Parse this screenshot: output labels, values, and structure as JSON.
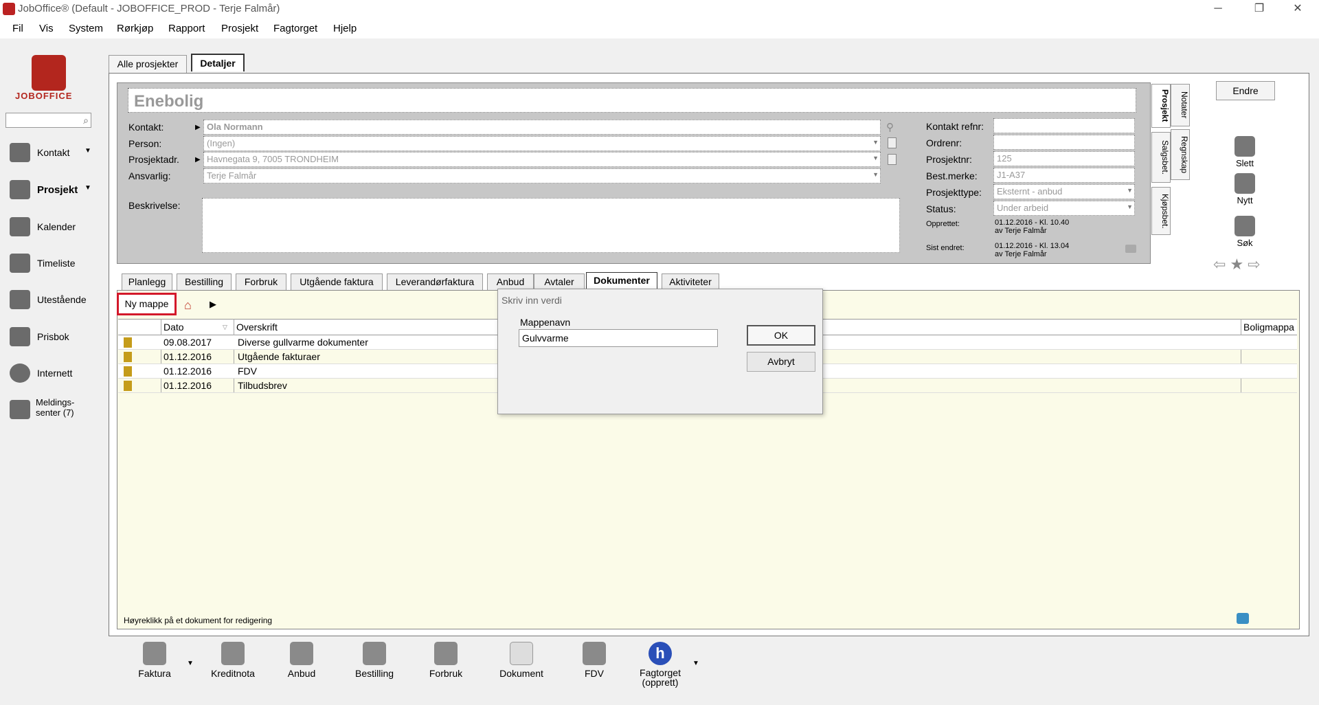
{
  "window": {
    "title": "JobOffice®    (Default - JOBOFFICE_PROD - Terje Falmår)",
    "minimize": "─",
    "restore": "❐",
    "close": "✕"
  },
  "menu": [
    "Fil",
    "Vis",
    "System",
    "Rørkjøp",
    "Rapport",
    "Prosjekt",
    "Fagtorget",
    "Hjelp"
  ],
  "sidebar": {
    "logo": "JOBOFFICE",
    "items": [
      {
        "label": "Kontakt",
        "icon": "contact-icon"
      },
      {
        "label": "Prosjekt",
        "icon": "project-icon"
      },
      {
        "label": "Kalender",
        "icon": "calendar-icon"
      },
      {
        "label": "Timeliste",
        "icon": "clock-icon"
      },
      {
        "label": "Utestående",
        "icon": "money-icon"
      },
      {
        "label": "Prisbok",
        "icon": "book-icon"
      },
      {
        "label": "Internett",
        "icon": "globe-icon"
      },
      {
        "label": "Meldings-",
        "label2": "senter (7)",
        "icon": "message-icon"
      }
    ]
  },
  "top_tabs": [
    "Alle prosjekter",
    "Detaljer"
  ],
  "project": {
    "title": "Enebolig",
    "labels": {
      "kontakt": "Kontakt:",
      "person": "Person:",
      "adresse": "Prosjektadr.",
      "ansvarlig": "Ansvarlig:",
      "beskrivelse": "Beskrivelse:"
    },
    "values": {
      "kontakt": "Ola Normann",
      "person": "(Ingen)",
      "adresse": "Havnegata 9, 7005 TRONDHEIM",
      "ansvarlig": "Terje Falmår"
    },
    "right_labels": {
      "refnr": "Kontakt refnr:",
      "ordrenr": "Ordrenr:",
      "prosjektnr": "Prosjektnr:",
      "bestmerke": "Best.merke:",
      "type": "Prosjekttype:",
      "status": "Status:",
      "opprettet": "Opprettet:",
      "endret": "Sist endret:"
    },
    "right_values": {
      "refnr": "",
      "ordrenr": "",
      "prosjektnr": "125",
      "bestmerke": "J1-A37",
      "type": "Eksternt - anbud",
      "status": "Under arbeid",
      "opprettet1": "01.12.2016 - Kl. 10.40",
      "opprettet2": "av Terje Falmår",
      "endret1": "01.12.2016 - Kl. 13.04",
      "endret2": "av Terje Falmår"
    }
  },
  "vertical_tabs": [
    "Prosjekt",
    "Notater",
    "Salgsbet.",
    "Regnskap",
    "Kjøpsbet."
  ],
  "actions": {
    "endre": "Endre",
    "slett": "Slett",
    "nytt": "Nytt",
    "sok": "Søk"
  },
  "sub_tabs": [
    "Planlegg",
    "Bestilling",
    "Forbruk",
    "Utgående faktura",
    "Leverandørfaktura",
    "Anbud",
    "Avtaler",
    "Dokumenter",
    "Aktiviteter"
  ],
  "doc_toolbar": {
    "ny_mappe": "Ny mappe"
  },
  "grid": {
    "headers": [
      "Dato",
      "Overskrift",
      "Boligmappa"
    ],
    "rows": [
      {
        "dato": "09.08.2017",
        "overskrift": "Diverse gullvarme dokumenter"
      },
      {
        "dato": "01.12.2016",
        "overskrift": "Utgående fakturaer"
      },
      {
        "dato": "01.12.2016",
        "overskrift": "FDV"
      },
      {
        "dato": "01.12.2016",
        "overskrift": "Tilbudsbrev"
      }
    ]
  },
  "status_hint": "Høyreklikk på et dokument for redigering",
  "dialog": {
    "title": "Skriv inn verdi",
    "label": "Mappenavn",
    "value": "Gulvvarme",
    "ok": "OK",
    "cancel": "Avbryt"
  },
  "bottom_tools": [
    "Faktura",
    "Kreditnota",
    "Anbud",
    "Bestilling",
    "Forbruk",
    "Dokument",
    "FDV",
    "Fagtorget",
    "(opprett)"
  ]
}
